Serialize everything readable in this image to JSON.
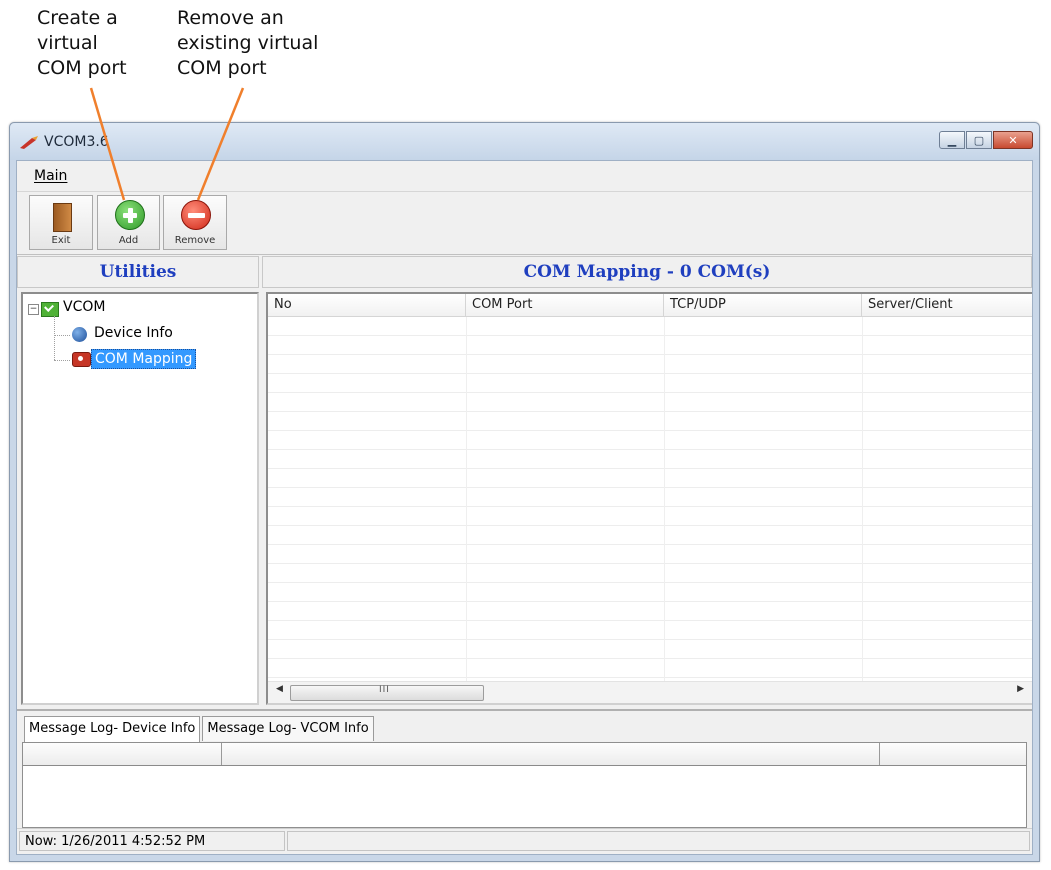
{
  "callouts": {
    "add": [
      "Create a",
      "virtual",
      "COM port"
    ],
    "remove": [
      "Remove an",
      "existing virtual",
      "COM port"
    ]
  },
  "colors": {
    "arrow": "#f07f2c",
    "panel_heading": "#1f3fbf",
    "selection": "#3399ff"
  },
  "window": {
    "title": "VCOM3.6",
    "controls": [
      "minimize-icon",
      "maximize-icon",
      "close-icon"
    ]
  },
  "menu": {
    "main": "Main"
  },
  "toolbar": {
    "exit": "Exit",
    "add": "Add",
    "remove": "Remove"
  },
  "utilities": {
    "heading": "Utilities",
    "tree": {
      "root": "VCOM",
      "children": [
        "Device Info",
        "COM Mapping"
      ],
      "selected": "COM Mapping"
    }
  },
  "mapping": {
    "heading": "COM Mapping - 0 COM(s)",
    "columns": [
      "No",
      "COM Port",
      "TCP/UDP",
      "Server/Client"
    ],
    "rows": [],
    "scrollbar_grip": "III"
  },
  "log": {
    "tabs": [
      "Message Log- Device Info",
      "Message Log- VCOM Info"
    ],
    "active_tab": 0
  },
  "status": {
    "now": "Now: 1/26/2011 4:52:52 PM"
  }
}
